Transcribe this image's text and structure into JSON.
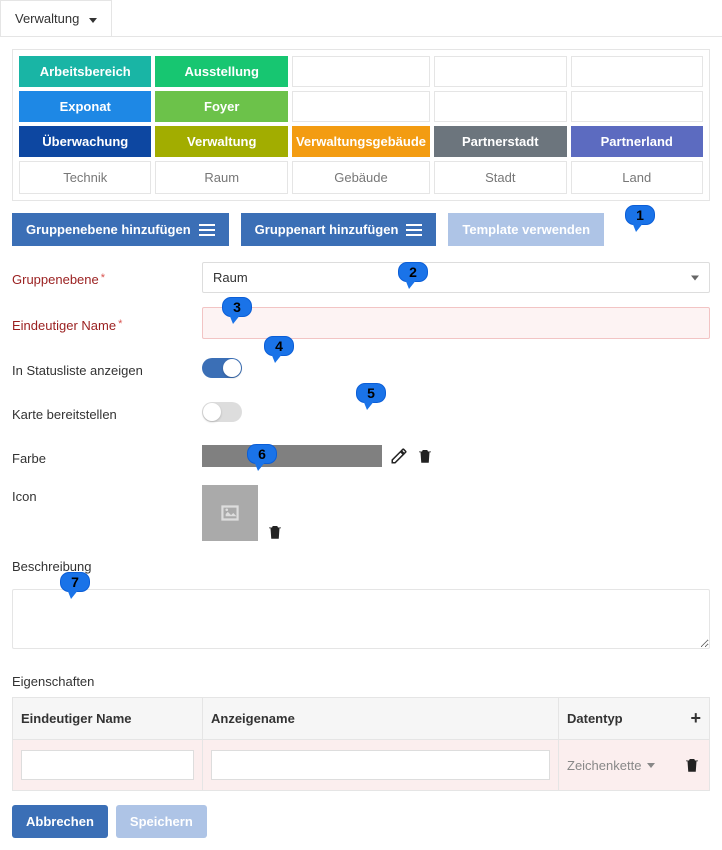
{
  "nav": {
    "item": "Verwaltung"
  },
  "tags": [
    {
      "label": "Arbeitsbereich",
      "bg": "#19b5a5"
    },
    {
      "label": "Ausstellung",
      "bg": "#17c671"
    },
    {
      "label": "",
      "bg": "transparent",
      "plain": true
    },
    {
      "label": "",
      "bg": "transparent",
      "plain": true
    },
    {
      "label": "",
      "bg": "transparent",
      "plain": true
    },
    {
      "label": "Exponat",
      "bg": "#1e88e5"
    },
    {
      "label": "Foyer",
      "bg": "#6cc24a"
    },
    {
      "label": "",
      "bg": "transparent",
      "plain": true
    },
    {
      "label": "",
      "bg": "transparent",
      "plain": true
    },
    {
      "label": "",
      "bg": "transparent",
      "plain": true
    },
    {
      "label": "Überwachung",
      "bg": "#0d47a1"
    },
    {
      "label": "Verwaltung",
      "bg": "#a2ad00"
    },
    {
      "label": "Verwaltungsgebäude",
      "bg": "#f39c12"
    },
    {
      "label": "Partnerstadt",
      "bg": "#6c757d"
    },
    {
      "label": "Partnerland",
      "bg": "#5c6bc0"
    },
    {
      "label": "Technik",
      "bg": "#fff",
      "plain": true
    },
    {
      "label": "Raum",
      "bg": "#fff",
      "plain": true
    },
    {
      "label": "Gebäude",
      "bg": "#fff",
      "plain": true
    },
    {
      "label": "Stadt",
      "bg": "#fff",
      "plain": true
    },
    {
      "label": "Land",
      "bg": "#fff",
      "plain": true
    }
  ],
  "actions": {
    "add_level": "Gruppenebene hinzufügen",
    "add_type": "Gruppenart hinzufügen",
    "use_template": "Template verwenden"
  },
  "form": {
    "level_label": "Gruppenebene",
    "level_value": "Raum",
    "name_label": "Eindeutiger Name",
    "name_value": "",
    "statuslist_label": "In Statusliste anzeigen",
    "statuslist_on": true,
    "map_label": "Karte bereitstellen",
    "map_on": false,
    "color_label": "Farbe",
    "color_value": "#808080",
    "icon_label": "Icon",
    "desc_label": "Beschreibung",
    "desc_value": ""
  },
  "properties": {
    "section_label": "Eigenschaften",
    "col_name": "Eindeutiger Name",
    "col_display": "Anzeigename",
    "col_type": "Datentyp",
    "row": {
      "name": "",
      "display": "",
      "type": "Zeichenkette"
    }
  },
  "footer": {
    "cancel": "Abbrechen",
    "save": "Speichern"
  },
  "callouts": [
    "1",
    "2",
    "3",
    "4",
    "5",
    "6",
    "7"
  ]
}
